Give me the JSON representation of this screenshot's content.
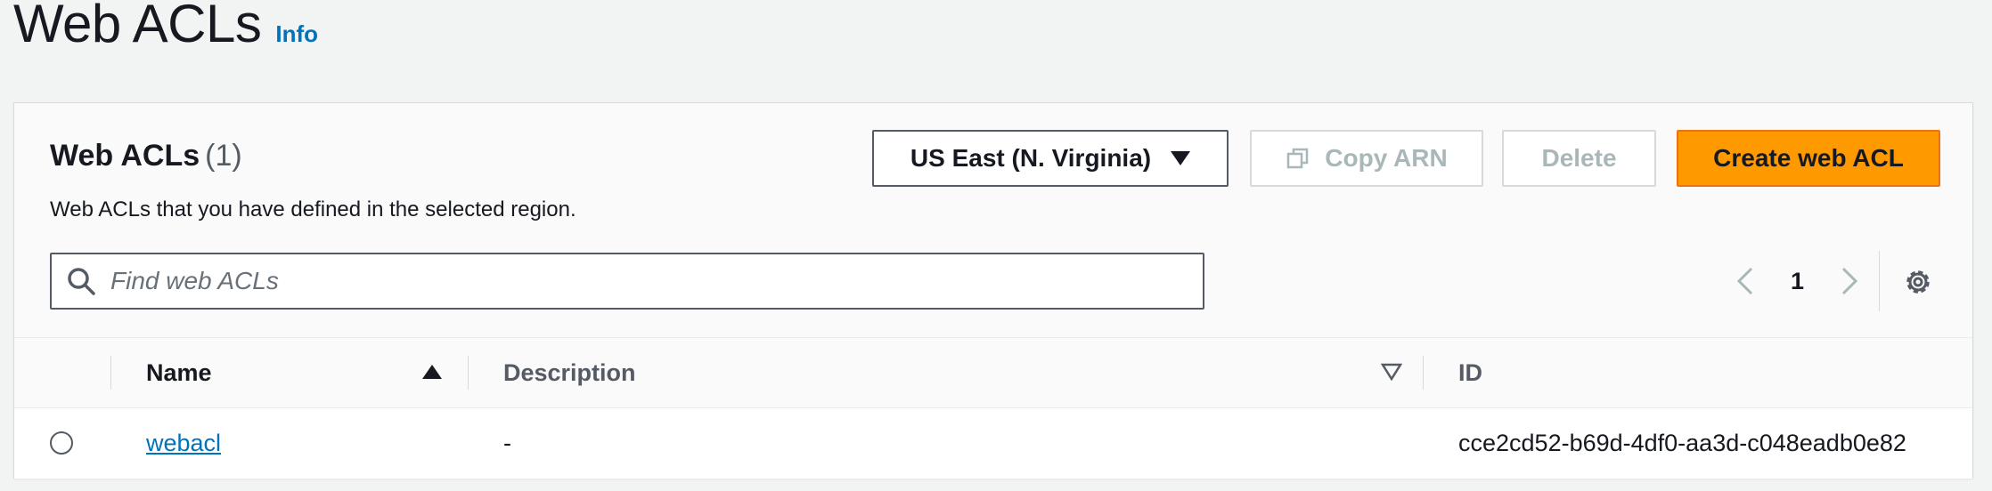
{
  "page": {
    "title": "Web ACLs",
    "info_link": "Info"
  },
  "panel": {
    "title": "Web ACLs",
    "count": "(1)",
    "description": "Web ACLs that you have defined in the selected region."
  },
  "toolbar": {
    "region_label": "US East (N. Virginia)",
    "copy_arn_label": "Copy ARN",
    "delete_label": "Delete",
    "create_label": "Create web ACL"
  },
  "search": {
    "placeholder": "Find web ACLs",
    "value": ""
  },
  "pagination": {
    "current_page": "1"
  },
  "table": {
    "columns": [
      "Name",
      "Description",
      "ID"
    ],
    "rows": [
      {
        "selected": false,
        "name": "webacl",
        "description": "-",
        "id": "cce2cd52-b69d-4df0-aa3d-c048eadb0e82"
      }
    ],
    "sorted_column": "Name",
    "sort_direction": "ascending"
  },
  "colors": {
    "background": "#f2f3f3",
    "panel": "#fafafa",
    "link": "#0073bb",
    "primary_button": "#ff9900",
    "disabled_text": "#aab7b8",
    "text": "#16191f"
  },
  "icons": {
    "region_dropdown": "caret-down-icon",
    "copy": "copy-icon",
    "search": "search-icon",
    "prev_page": "chevron-left-icon",
    "next_page": "chevron-right-icon",
    "settings": "gear-icon",
    "sort_name": "sort-ascending-icon",
    "sort_description": "sort-descending-outline-icon"
  }
}
